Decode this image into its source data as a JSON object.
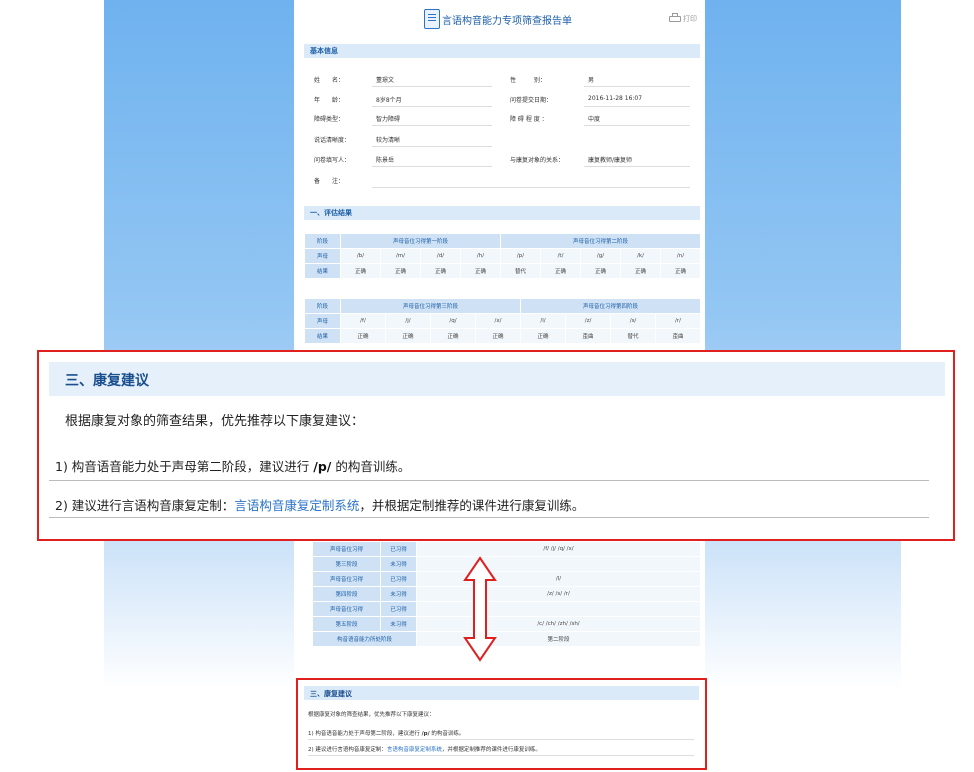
{
  "report": {
    "title": "言语构音能力专项筛查报告单",
    "print_label": "打印",
    "basic_section": "基本信息",
    "fields": [
      {
        "label": "姓　　名：",
        "value": "董璟文"
      },
      {
        "label": "性　　　别：",
        "value": "男"
      },
      {
        "label": "年　　龄：",
        "value": "8岁8个月"
      },
      {
        "label": "问卷提交日期：",
        "value": "2016-11-28 16:07"
      },
      {
        "label": "障碍类型：",
        "value": "智力障碍"
      },
      {
        "label": "障 碍 程 度 ：",
        "value": "中度"
      },
      {
        "label": "说话清晰度：",
        "value": "较为清晰"
      },
      {
        "label": "问卷填写人：",
        "value": "陈景岳"
      },
      {
        "label": "与康复对象的关系：",
        "value": "康复教师/康复师"
      },
      {
        "label": "备　　注：",
        "value": ""
      }
    ],
    "eval_section": "一、评估结果",
    "table1": {
      "stage_label": "阶段",
      "initial_label": "声母",
      "result_label": "结果",
      "stage_a": "声母音位习得第一阶段",
      "stage_b": "声母音位习得第二阶段",
      "initials": [
        "/b/",
        "/m/",
        "/d/",
        "/h/",
        "/p/",
        "/t/",
        "/g/",
        "/k/",
        "/n/"
      ],
      "results": [
        "正确",
        "正确",
        "正确",
        "正确",
        "替代",
        "正确",
        "正确",
        "正确",
        "正确"
      ]
    },
    "table2": {
      "stage_label": "阶段",
      "initial_label": "声母",
      "result_label": "结果",
      "stage_a": "声母音位习得第三阶段",
      "stage_b": "声母音位习得第四阶段",
      "initials": [
        "/f/",
        "/j/",
        "/q/",
        "/x/",
        "/l/",
        "/z/",
        "/s/",
        "/r/"
      ],
      "results": [
        "正确",
        "正确",
        "正确",
        "正确",
        "正确",
        "歪曲",
        "替代",
        "歪曲"
      ]
    },
    "table3": {
      "rows": [
        {
          "stage": "声母音位习得",
          "status": "已习得",
          "value": "/f/  /j/  /q/  /x/"
        },
        {
          "stage": "第三阶段",
          "status": "未习得",
          "value": ""
        },
        {
          "stage": "声母音位习得",
          "status": "已习得",
          "value": "/l/"
        },
        {
          "stage": "第四阶段",
          "status": "未习得",
          "value": "/z/  /s/  /r/"
        },
        {
          "stage": "声母音位习得",
          "status": "已习得",
          "value": ""
        },
        {
          "stage": "第五阶段",
          "status": "未习得",
          "value": "/c/  /ch/  /zh/  /sh/"
        }
      ],
      "summary_label": "构音语音能力所处阶段",
      "summary_value": "第二阶段"
    }
  },
  "recommendation": {
    "title": "三、康复建议",
    "intro": "根据康复对象的筛查结果，优先推荐以下康复建议：",
    "item1_prefix": "1) 构音语音能力处于声母第二阶段，建议进行 ",
    "item1_bold": "/p/",
    "item1_suffix": " 的构音训练。",
    "item2_prefix": "2) 建议进行言语构音康复定制：",
    "item2_link": "言语构音康复定制系统",
    "item2_suffix": "，并根据定制推荐的课件进行康复训练。"
  },
  "colors": {
    "accent": "#1d5fa8",
    "highlight": "#e01f1f",
    "link": "#2a73c8",
    "header_bg": "#dbeaf8"
  }
}
